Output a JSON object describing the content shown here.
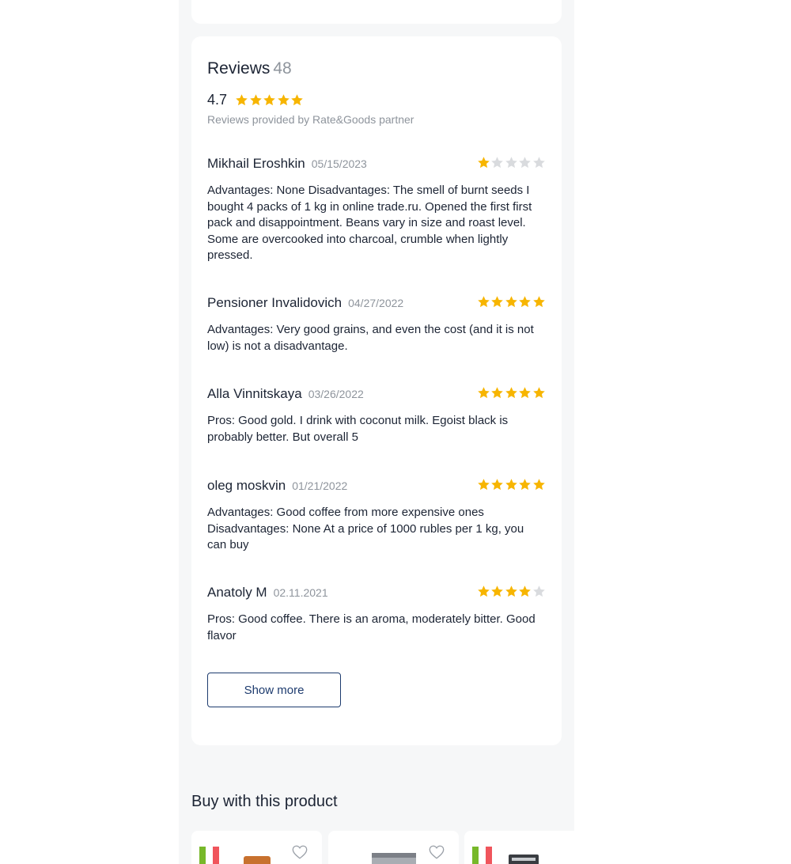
{
  "reviews": {
    "title": "Reviews",
    "count": "48",
    "rating_value": "4.7",
    "rating_stars": 5,
    "provided_by": "Reviews provided by Rate&Goods partner",
    "items": [
      {
        "name": "Mikhail Eroshkin",
        "date": "05/15/2023",
        "stars": 1,
        "text": "Advantages: None Disadvantages: The smell of burnt seeds I bought 4 packs of 1 kg in online trade.ru. Opened the first first pack and disappointment. Beans vary in size and roast level. Some are overcooked into charcoal, crumble when lightly pressed."
      },
      {
        "name": "Pensioner Invalidovich",
        "date": "04/27/2022",
        "stars": 5,
        "text": "Advantages: Very good grains, and even the cost (and it is not low) is not a disadvantage."
      },
      {
        "name": "Alla Vinnitskaya",
        "date": "03/26/2022",
        "stars": 5,
        "text": "Pros: Good gold. I drink with coconut milk. Egoist black is probably better. But overall 5"
      },
      {
        "name": "oleg moskvin",
        "date": "01/21/2022",
        "stars": 5,
        "text": "Advantages: Good coffee from more expensive ones Disadvantages: None At a price of 1000 rubles per 1 kg, you can buy"
      },
      {
        "name": "Anatoly M",
        "date": "02.11.2021",
        "stars": 4,
        "text": "Pros: Good coffee. There is an aroma, moderately bitter. Good flavor"
      }
    ],
    "show_more_label": "Show more"
  },
  "buy_with": {
    "title": "Buy with this product",
    "products": [
      {
        "flag": "italy-flag",
        "icon": "heart-icon"
      },
      {
        "flag": "",
        "icon": "heart-icon"
      },
      {
        "flag": "italy-flag",
        "icon": "heart-icon"
      }
    ]
  },
  "colors": {
    "star_filled": "#f7b500",
    "star_empty": "#d9dbde",
    "accent": "#1d3b6e",
    "muted": "#8e949c"
  }
}
